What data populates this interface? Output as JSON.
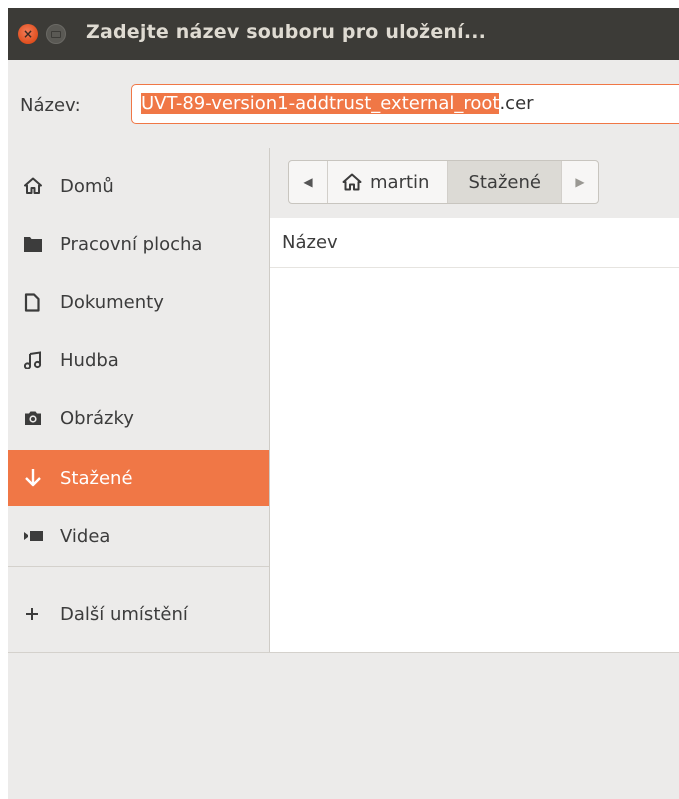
{
  "window": {
    "title": "Zadejte název souboru pro uložení..."
  },
  "filename": {
    "label": "Název:",
    "selected_text": "UVT-89-version1-addtrust_external_root",
    "rest_text": ".cer"
  },
  "sidebar": {
    "items": [
      {
        "label": "Domů",
        "icon": "home-icon"
      },
      {
        "label": "Pracovní plocha",
        "icon": "desktop-folder-icon"
      },
      {
        "label": "Dokumenty",
        "icon": "document-icon"
      },
      {
        "label": "Hudba",
        "icon": "music-icon"
      },
      {
        "label": "Obrázky",
        "icon": "camera-icon"
      },
      {
        "label": "Stažené",
        "icon": "download-icon",
        "active": true
      },
      {
        "label": "Videa",
        "icon": "video-icon"
      }
    ],
    "other_locations": {
      "label": "Další umístění",
      "icon": "plus-icon"
    }
  },
  "pathbar": {
    "home_label": "martin",
    "current_label": "Stažené"
  },
  "file_list": {
    "column_header": "Název"
  },
  "colors": {
    "accent": "#f07746",
    "titlebar": "#3c3b37",
    "sidebar_bg": "#ecebea"
  }
}
